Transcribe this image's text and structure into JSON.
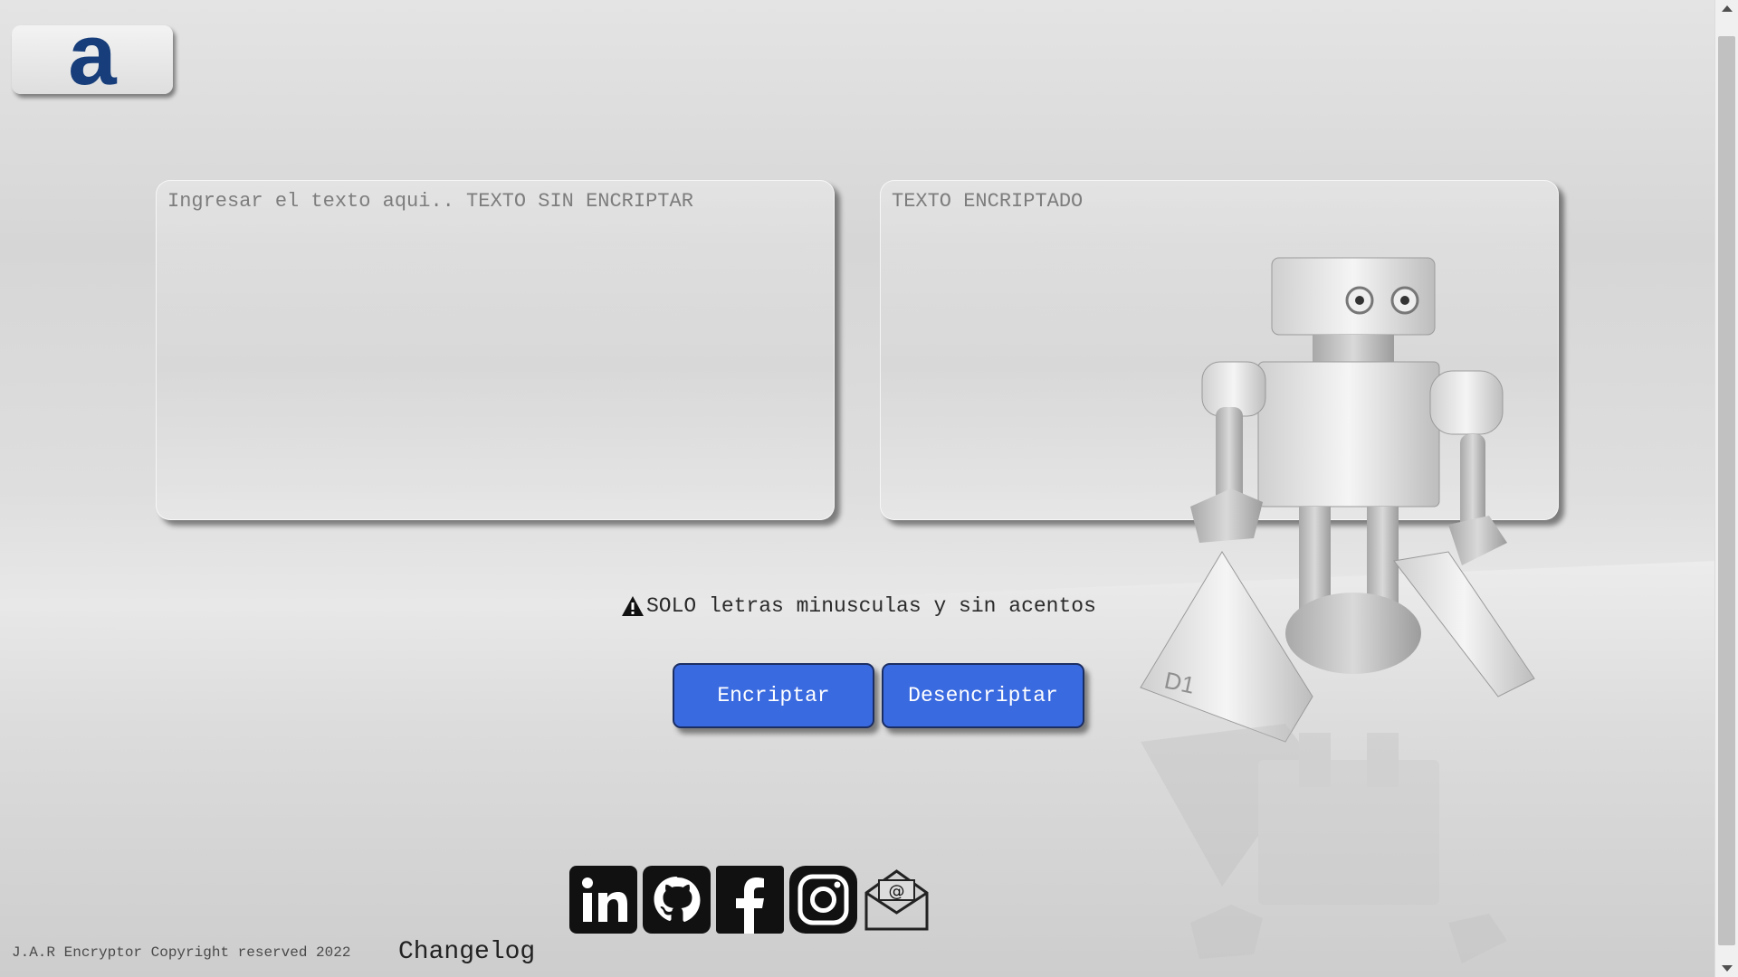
{
  "logo": {
    "letter": "a",
    "icon": "logo-a-icon",
    "color": "#173e7a"
  },
  "input": {
    "placeholder": "Ingresar el texto aqui.. TEXTO SIN ENCRIPTAR",
    "value": ""
  },
  "output": {
    "label": "TEXTO ENCRIPTADO",
    "value": ""
  },
  "warning": {
    "icon": "warning-icon",
    "text": "SOLO letras minusculas y sin acentos"
  },
  "buttons": {
    "encrypt": "Encriptar",
    "decrypt": "Desencriptar",
    "color": "#3a6ae0"
  },
  "social": [
    {
      "name": "linkedin-icon"
    },
    {
      "name": "github-icon"
    },
    {
      "name": "facebook-icon"
    },
    {
      "name": "instagram-icon"
    },
    {
      "name": "email-icon"
    }
  ],
  "robot": {
    "badge": "D1"
  },
  "footer": {
    "copyright": "J.A.R Encryptor Copyright reserved 2022",
    "changelog": "Changelog"
  }
}
